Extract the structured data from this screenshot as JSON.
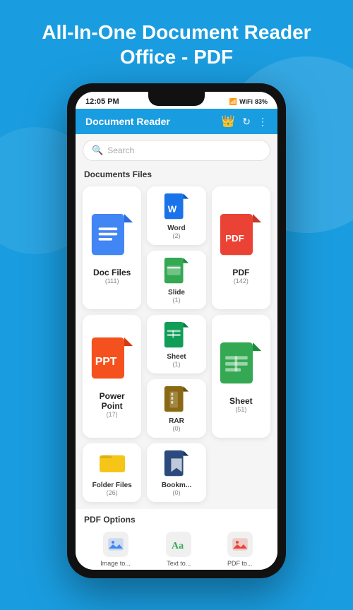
{
  "header": {
    "title": "All-In-One Document Reader Office - PDF"
  },
  "statusBar": {
    "time": "12:05 PM",
    "battery": "83%",
    "signal": "▂▄▆"
  },
  "appBar": {
    "title": "Document Reader"
  },
  "search": {
    "placeholder": "Search"
  },
  "sections": {
    "documents": {
      "title": "Documents Files",
      "cards": [
        {
          "label": "Doc Files",
          "count": "(111)",
          "type": "doc",
          "size": "large"
        },
        {
          "label": "Word",
          "count": "(2)",
          "type": "word",
          "size": "small"
        },
        {
          "label": "PDF",
          "count": "(142)",
          "type": "pdf",
          "size": "large"
        },
        {
          "label": "Slide",
          "count": "(1)",
          "type": "slide",
          "size": "small"
        },
        {
          "label": "Sheet",
          "count": "(1)",
          "type": "sheet",
          "size": "small"
        },
        {
          "label": "Power Point",
          "count": "(17)",
          "type": "ppt",
          "size": "large"
        },
        {
          "label": "RAR",
          "count": "(0)",
          "type": "rar",
          "size": "small"
        },
        {
          "label": "Sheet",
          "count": "(51)",
          "type": "sheet-large",
          "size": "large"
        },
        {
          "label": "Folder Files",
          "count": "(26)",
          "type": "folder",
          "size": "small"
        },
        {
          "label": "Bookm...",
          "count": "(0)",
          "type": "bookmark",
          "size": "small"
        }
      ]
    },
    "pdfOptions": {
      "title": "PDF Options",
      "items": [
        {
          "label": "Image to...",
          "icon": "🖼️"
        },
        {
          "label": "Text to...",
          "icon": "Aa"
        },
        {
          "label": "PDF to...",
          "icon": "🖼️"
        }
      ]
    }
  }
}
